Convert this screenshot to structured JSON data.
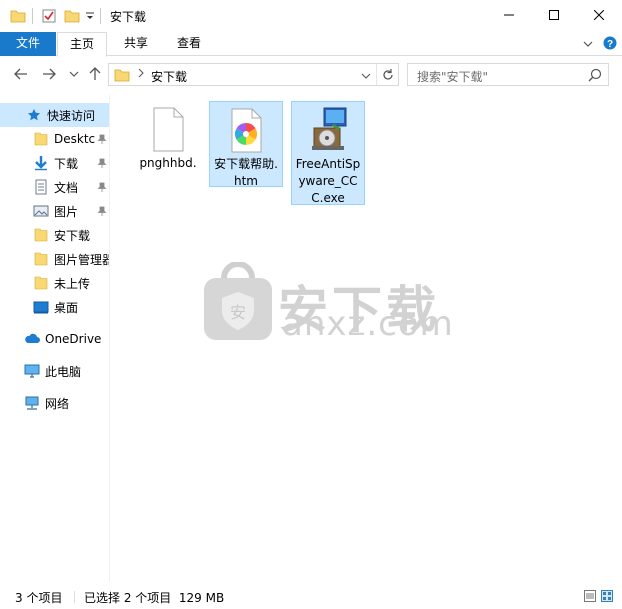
{
  "window": {
    "title": "安下载",
    "controls": [
      "minimize",
      "maximize",
      "close"
    ]
  },
  "ribbon": {
    "tabs": [
      {
        "label": "文件"
      },
      {
        "label": "主页"
      },
      {
        "label": "共享"
      },
      {
        "label": "查看"
      }
    ]
  },
  "address": {
    "path": "安下载",
    "search_placeholder": "搜索\"安下载\""
  },
  "nav": {
    "items": [
      {
        "label": "快速访问",
        "icon": "star-icon"
      },
      {
        "label": "Desktc",
        "icon": "folder-icon",
        "pinned": true
      },
      {
        "label": "下载",
        "icon": "download-icon",
        "pinned": true
      },
      {
        "label": "文档",
        "icon": "document-icon",
        "pinned": true
      },
      {
        "label": "图片",
        "icon": "pictures-icon",
        "pinned": true
      },
      {
        "label": "安下载",
        "icon": "folder-icon"
      },
      {
        "label": "图片管理器",
        "icon": "folder-icon"
      },
      {
        "label": "未上传",
        "icon": "folder-icon"
      },
      {
        "label": "桌面",
        "icon": "desktop-icon"
      },
      {
        "label": "OneDrive",
        "icon": "cloud-icon"
      },
      {
        "label": "此电脑",
        "icon": "computer-icon"
      },
      {
        "label": "网络",
        "icon": "network-icon"
      }
    ]
  },
  "files": [
    {
      "name": "pnghhbd.",
      "icon": "blank-file-icon",
      "selected": false
    },
    {
      "name": "安下载帮助.htm",
      "icon": "html-file-icon",
      "selected": true
    },
    {
      "name": "FreeAntiSpyware_CCC.exe",
      "icon": "installer-icon",
      "selected": true
    }
  ],
  "watermark": {
    "text": "安下载",
    "sub": "anxz.com"
  },
  "status": {
    "count": "3 个项目",
    "selection": "已选择 2 个项目  129 MB"
  },
  "colors": {
    "accent": "#1979ca",
    "selection": "#cce8ff",
    "folder": "#f8d775"
  }
}
